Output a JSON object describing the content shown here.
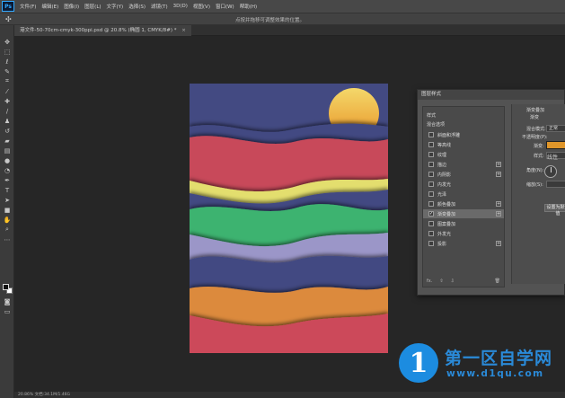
{
  "app": {
    "logo": "Ps"
  },
  "menu": [
    "文件(F)",
    "编辑(E)",
    "图像(I)",
    "图层(L)",
    "文字(Y)",
    "选择(S)",
    "滤镜(T)",
    "3D(D)",
    "视图(V)",
    "窗口(W)",
    "帮助(H)"
  ],
  "options": {
    "hint": "点按并拖移可调整效果的位置。"
  },
  "document": {
    "tab_label": "港文件-50-70cm-cmyk-300ppi.psd @ 20.8% (椭圆 1, CMYK/8#) *",
    "close": "×"
  },
  "status": {
    "text": "20.86%     文档:34.1M/1.46G"
  },
  "artwork": {
    "background_color": "#434a82",
    "sun_color": "#f3c23a",
    "wave_colors": [
      "#434a82",
      "#c84a5a",
      "#e3de6e",
      "#434a82",
      "#3eb36f",
      "#9b96c8",
      "#434a82",
      "#dc8a3c",
      "#cc4a5a"
    ]
  },
  "dialog": {
    "title": "图层样式",
    "styles_header": "样式",
    "blend_options": "混合选项",
    "items": [
      {
        "label": "斜面和浮雕",
        "checked": false,
        "has_plus": false
      },
      {
        "label": "等高线",
        "checked": false,
        "has_plus": false
      },
      {
        "label": "纹理",
        "checked": false,
        "has_plus": false
      },
      {
        "label": "描边",
        "checked": false,
        "has_plus": true
      },
      {
        "label": "内阴影",
        "checked": false,
        "has_plus": true
      },
      {
        "label": "内发光",
        "checked": false,
        "has_plus": false
      },
      {
        "label": "光泽",
        "checked": false,
        "has_plus": false
      },
      {
        "label": "颜色叠加",
        "checked": false,
        "has_plus": true
      },
      {
        "label": "渐变叠加",
        "checked": true,
        "has_plus": true
      },
      {
        "label": "图案叠加",
        "checked": false,
        "has_plus": false
      },
      {
        "label": "外发光",
        "checked": false,
        "has_plus": false
      },
      {
        "label": "投影",
        "checked": false,
        "has_plus": true
      }
    ],
    "fx_label": "fx.",
    "right": {
      "section_title": "渐变叠加",
      "subsection": "渐变",
      "blend_mode_label": "混合模式:",
      "blend_mode_value": "正常",
      "opacity_label": "不透明度(P):",
      "gradient_label": "渐变:",
      "style_label": "样式:",
      "style_value": "线性",
      "angle_label": "角度(N):",
      "scale_label": "缩放(S):",
      "reset_button": "设置为默认值",
      "gradient_color": "#e0962a"
    }
  },
  "watermark": {
    "logo_char": "1",
    "title": "第一区自学网",
    "url": "www.d1qu.com"
  }
}
